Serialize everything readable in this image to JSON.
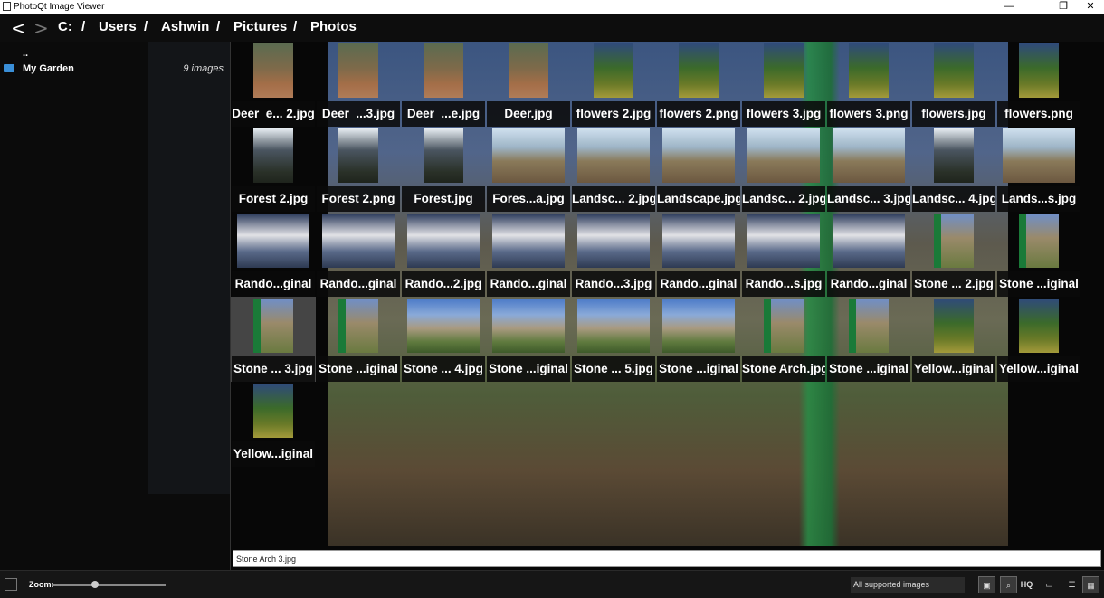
{
  "window": {
    "title": "PhotoQt Image Viewer",
    "minimize": "—",
    "maximize": "❐",
    "close": "✕"
  },
  "nav": {
    "back": "<",
    "forward": ">"
  },
  "breadcrumb": [
    "C:",
    "Users",
    "Ashwin",
    "Pictures",
    "Photos"
  ],
  "breadcrumb_separator": "/",
  "folders": [
    {
      "name": "..",
      "count": ""
    },
    {
      "name": "My Garden",
      "count": "9 images"
    }
  ],
  "files": [
    {
      "label": "Deer_e... 2.jpg",
      "kind": "dirt"
    },
    {
      "label": "Deer_...3.jpg",
      "kind": "dirt"
    },
    {
      "label": "Deer_...e.jpg",
      "kind": "dirt"
    },
    {
      "label": "Deer.jpg",
      "kind": "dirt"
    },
    {
      "label": "flowers 2.jpg",
      "kind": "tree"
    },
    {
      "label": "flowers 2.png",
      "kind": "tree"
    },
    {
      "label": "flowers 3.jpg",
      "kind": "tree"
    },
    {
      "label": "flowers 3.png",
      "kind": "tree"
    },
    {
      "label": "flowers.jpg",
      "kind": "tree"
    },
    {
      "label": "flowers.png",
      "kind": "tree"
    },
    {
      "label": "Forest 2.jpg",
      "kind": "forest"
    },
    {
      "label": "Forest 2.png",
      "kind": "forest"
    },
    {
      "label": "Forest.jpg",
      "kind": "forest"
    },
    {
      "label": "Fores...a.jpg",
      "kind": "land"
    },
    {
      "label": "Landsc... 2.jpg",
      "kind": "land"
    },
    {
      "label": "Landscape.jpg",
      "kind": "land"
    },
    {
      "label": "Landsc... 2.jpg",
      "kind": "land"
    },
    {
      "label": "Landsc... 3.jpg",
      "kind": "land"
    },
    {
      "label": "Landsc... 4.jpg",
      "kind": "forest"
    },
    {
      "label": "Lands...s.jpg",
      "kind": "land"
    },
    {
      "label": "Rando...ginal",
      "kind": "random"
    },
    {
      "label": "Rando...ginal",
      "kind": "random"
    },
    {
      "label": "Rando...2.jpg",
      "kind": "random"
    },
    {
      "label": "Rando...ginal",
      "kind": "random"
    },
    {
      "label": "Rando...3.jpg",
      "kind": "random"
    },
    {
      "label": "Rando...ginal",
      "kind": "random"
    },
    {
      "label": "Rando...s.jpg",
      "kind": "random"
    },
    {
      "label": "Rando...ginal",
      "kind": "random"
    },
    {
      "label": "Stone ... 2.jpg",
      "kind": "green"
    },
    {
      "label": "Stone ...iginal",
      "kind": "green"
    },
    {
      "label": "Stone ... 3.jpg",
      "kind": "green",
      "selected": true
    },
    {
      "label": "Stone ...iginal",
      "kind": "green"
    },
    {
      "label": "Stone ... 4.jpg",
      "kind": "stone"
    },
    {
      "label": "Stone ...iginal",
      "kind": "stone"
    },
    {
      "label": "Stone ... 5.jpg",
      "kind": "stone"
    },
    {
      "label": "Stone ...iginal",
      "kind": "stone"
    },
    {
      "label": "Stone Arch.jpg",
      "kind": "green"
    },
    {
      "label": "Stone ...iginal",
      "kind": "green"
    },
    {
      "label": "Yellow...iginal",
      "kind": "tree"
    },
    {
      "label": "Yellow...iginal",
      "kind": "tree"
    },
    {
      "label": "Yellow...iginal",
      "kind": "tree"
    }
  ],
  "filename_field": {
    "value": "Stone Arch 3.jpg"
  },
  "bottom": {
    "zoom_label": "Zoom:",
    "zoom_level": 0.38,
    "filetype_filter": "All supported images",
    "hq_label": "HQ"
  },
  "icons": {
    "app": "photoqt-icon",
    "folder": "folder-icon",
    "grid": "grid-view-icon",
    "list": "list-view-icon",
    "preview": "preview-icon",
    "hq": "hq-icon",
    "image": "image-icon"
  }
}
